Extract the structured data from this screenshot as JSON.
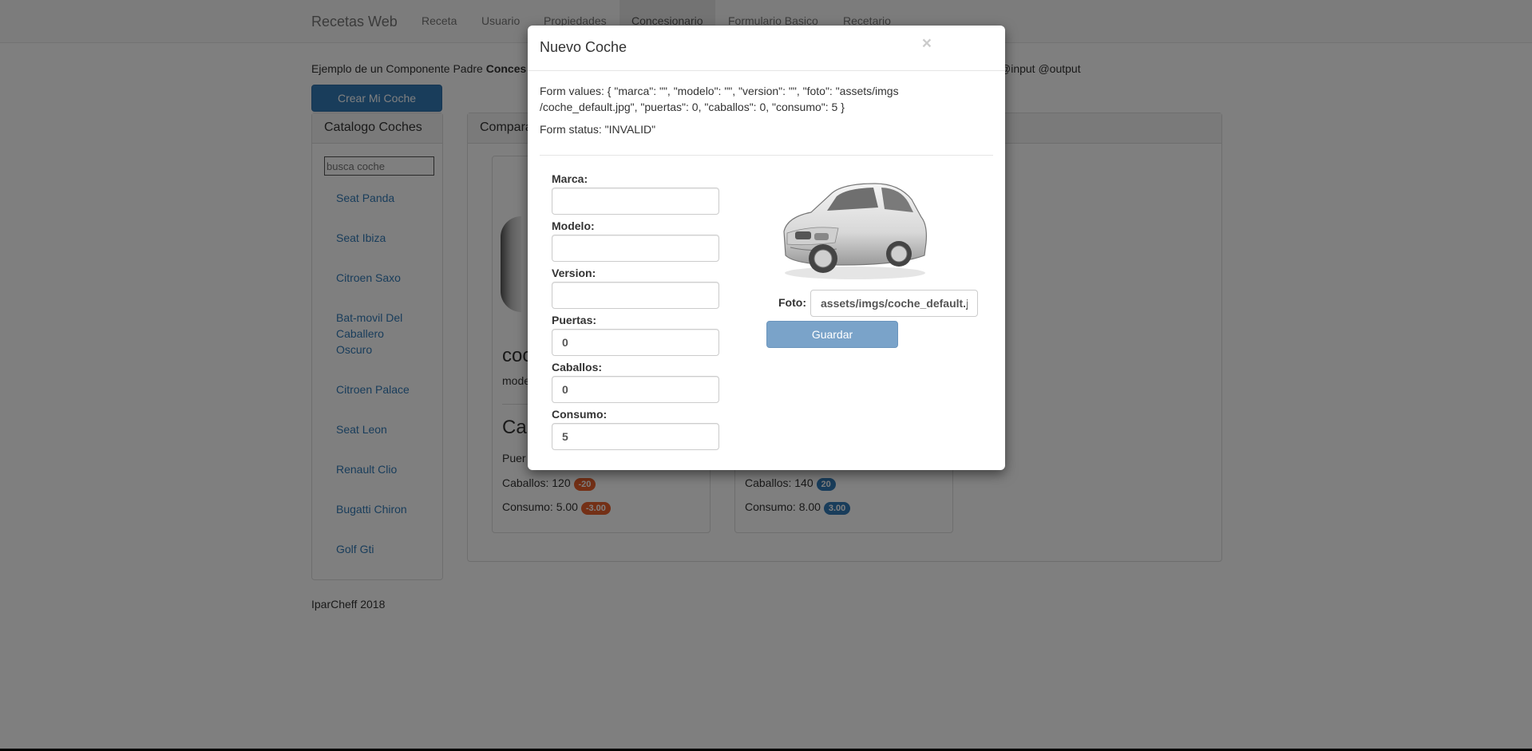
{
  "navbar": {
    "brand": "Recetas Web",
    "items": [
      {
        "label": "Receta"
      },
      {
        "label": "Usuario"
      },
      {
        "label": "Propiedades"
      },
      {
        "label": "Concesionario"
      },
      {
        "label": "Formulario Basico"
      },
      {
        "label": "Recetario"
      }
    ]
  },
  "intro": {
    "prefix": "Ejemplo de un Componente Padre ",
    "bold": "Conces",
    "tail": "@input @output"
  },
  "create_button": "Crear Mi Coche",
  "catalog": {
    "title": "Catalogo Coches",
    "search_placeholder": "busca coche",
    "items": [
      "Seat Panda",
      "Seat Ibiza",
      "Citroen Saxo",
      "Bat-movil Del Caballero Oscuro",
      "Citroen Palace",
      "Seat Leon",
      "Renault Clio",
      "Bugatti Chiron",
      "Golf Gti"
    ]
  },
  "compare": {
    "title": "Compara",
    "card1": {
      "name": "coc",
      "model": "mode",
      "section": "Ca",
      "puertas": "Puer",
      "caballos_label": "Caballos: 120",
      "caballos_badge": "-20",
      "consumo_label": "Consumo: 5.00",
      "consumo_badge": "-3.00"
    },
    "card2": {
      "caballos_label": "Caballos: 140",
      "caballos_badge": "20",
      "consumo_label": "Consumo: 8.00",
      "consumo_badge": "3.00"
    }
  },
  "footer": "IparCheff 2018",
  "modal": {
    "title": "Nuevo Coche",
    "close": "×",
    "form_values": "Form values: { \"marca\": \"\", \"modelo\": \"\", \"version\": \"\", \"foto\": \"assets/imgs /coche_default.jpg\", \"puertas\": 0, \"caballos\": 0, \"consumo\": 5 }",
    "form_status": "Form status: \"INVALID\"",
    "fields": {
      "marca": {
        "label": "Marca:",
        "value": ""
      },
      "modelo": {
        "label": "Modelo:",
        "value": ""
      },
      "version": {
        "label": "Version:",
        "value": ""
      },
      "puertas": {
        "label": "Puertas:",
        "value": "0"
      },
      "caballos": {
        "label": "Caballos:",
        "value": "0"
      },
      "consumo": {
        "label": "Consumo:",
        "value": "5"
      }
    },
    "foto": {
      "label": "Foto:",
      "value": "assets/imgs/coche_default.jpg"
    },
    "save_button": "Guardar"
  },
  "colors": {
    "primary": "#337ab7",
    "badge_red": "#d9534f",
    "badge_orange": "#e8612c",
    "badge_blue": "#337ab7"
  }
}
